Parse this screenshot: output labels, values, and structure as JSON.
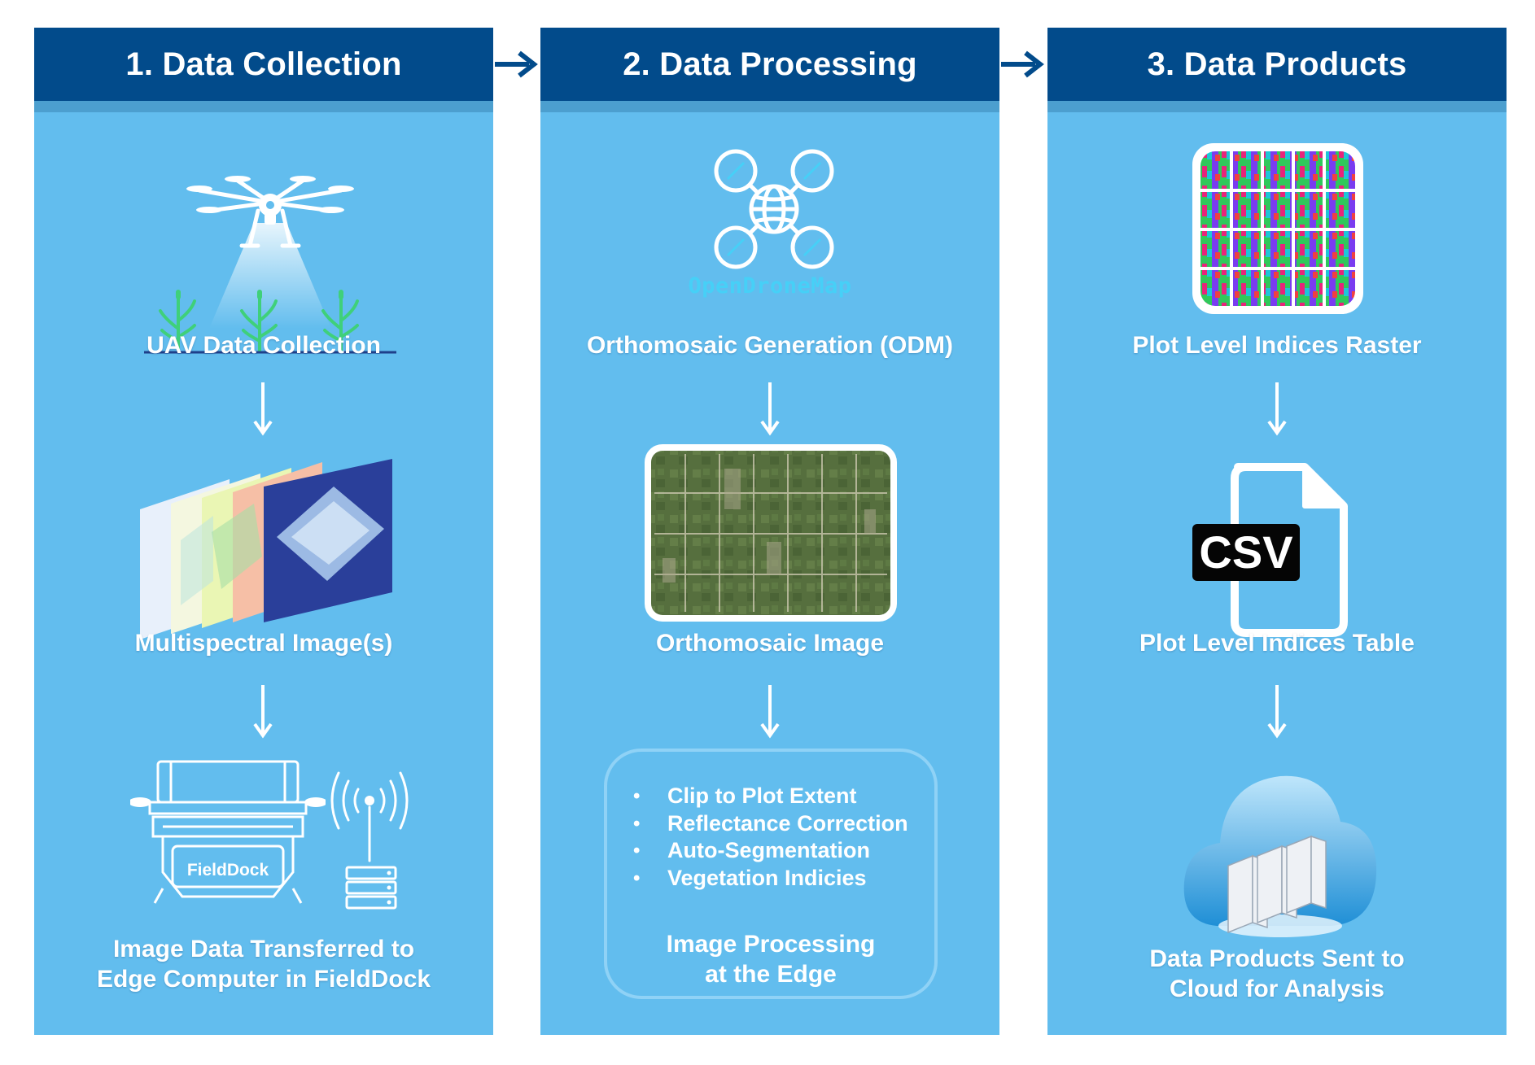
{
  "columns": [
    {
      "title": "1. Data Collection",
      "step1_label": "UAV Data Collection",
      "step2_label": "Multispectral Image(s)",
      "step3_label_line1": "Image Data Transferred to",
      "step3_label_line2": "Edge Computer in FieldDock",
      "device_logo": "FieldDock"
    },
    {
      "title": "2. Data Processing",
      "logo_text": "OpenDroneMap",
      "step1_label": "Orthomosaic Generation (ODM)",
      "step2_label": "Orthomosaic Image",
      "processing_steps": [
        "Clip to Plot Extent",
        "Reflectance Correction",
        "Auto-Segmentation",
        "Vegetation Indicies"
      ],
      "processing_title_line1": "Image Processing",
      "processing_title_line2": "at the Edge"
    },
    {
      "title": "3. Data Products",
      "step1_label": "Plot Level Indices Raster",
      "csv_text": "CSV",
      "step2_label": "Plot Level Indices Table",
      "step3_label_line1": "Data Products Sent to",
      "step3_label_line2": "Cloud for Analysis"
    }
  ],
  "colors": {
    "header": "#024b8b",
    "panel": "#62bdee",
    "text": "#ffffff",
    "arrow": "#024b8b"
  },
  "icons": [
    "drone-icon",
    "crop-plant-icon",
    "image-stack-icon",
    "fielddock-icon",
    "antenna-icon",
    "server-icon",
    "opendronemap-icon",
    "orthomosaic-icon",
    "raster-icon",
    "csv-file-icon",
    "cloud-server-icon"
  ]
}
